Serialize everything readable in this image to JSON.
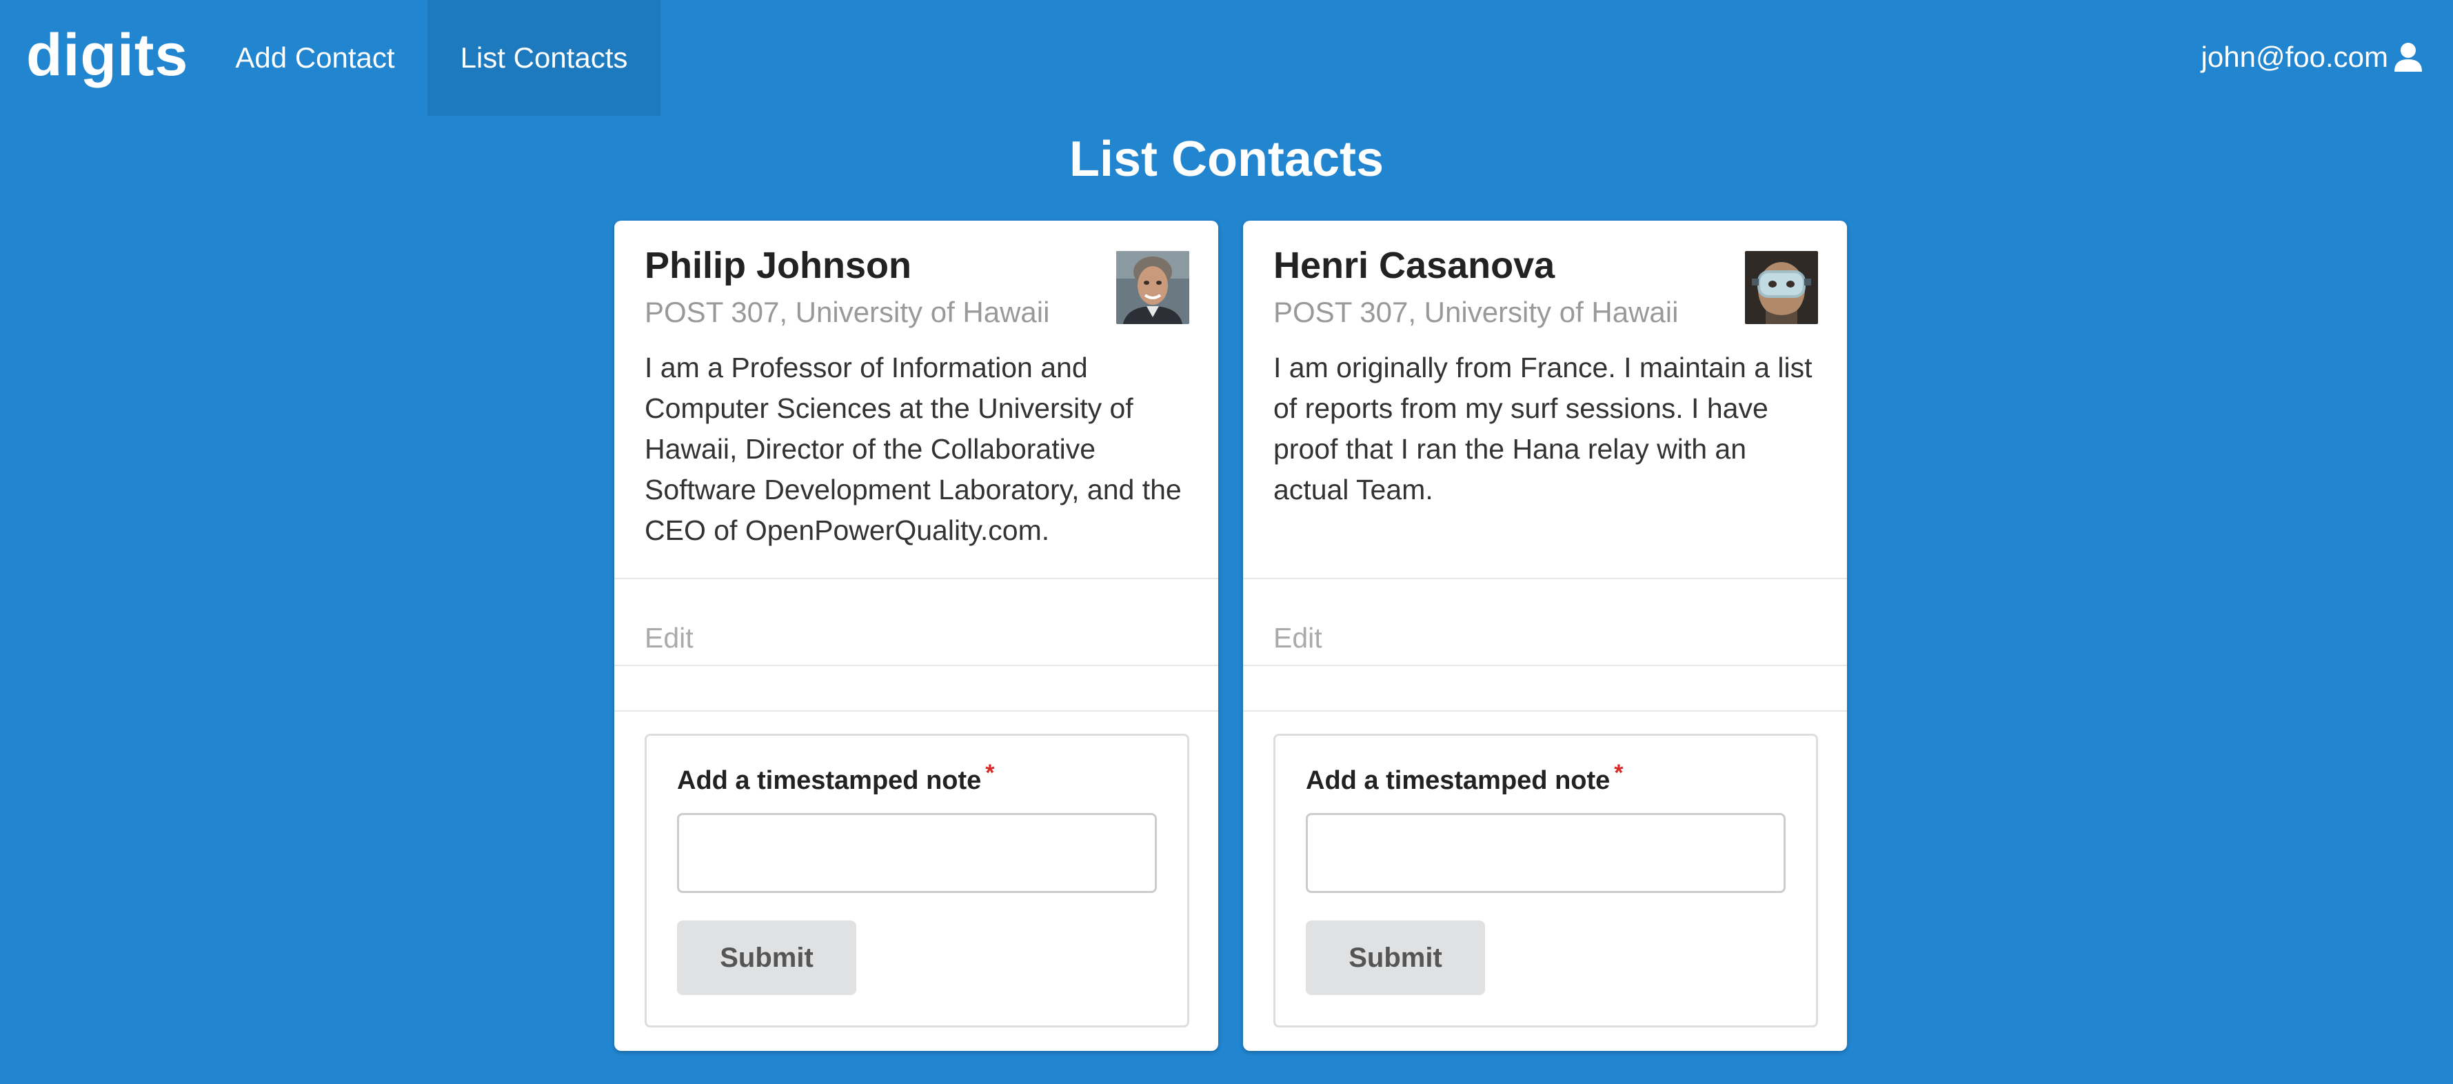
{
  "navbar": {
    "brand": "digits",
    "items": [
      {
        "label": "Add Contact",
        "active": false
      },
      {
        "label": "List Contacts",
        "active": true
      }
    ],
    "user": "john@foo.com",
    "user_icon": "user-icon"
  },
  "page": {
    "title": "List Contacts"
  },
  "contacts": [
    {
      "name": "Philip Johnson",
      "meta": "POST 307, University of Hawaii",
      "description": "I am a Professor of Information and Computer Sciences at the University of Hawaii, Director of the Collaborative Software Development Laboratory, and the CEO of OpenPowerQuality.com.",
      "edit_label": "Edit",
      "note_label": "Add a timestamped note",
      "required_marker": "*",
      "note_value": "",
      "submit_label": "Submit"
    },
    {
      "name": "Henri Casanova",
      "meta": "POST 307, University of Hawaii",
      "description": "I am originally from France. I maintain a list of reports from my surf sessions. I have proof that I ran the Hana relay with an actual Team.",
      "edit_label": "Edit",
      "note_label": "Add a timestamped note",
      "required_marker": "*",
      "note_value": "",
      "submit_label": "Submit"
    }
  ],
  "colors": {
    "background": "#2185d0",
    "required": "#db2828",
    "button": "#e0e1e2"
  }
}
